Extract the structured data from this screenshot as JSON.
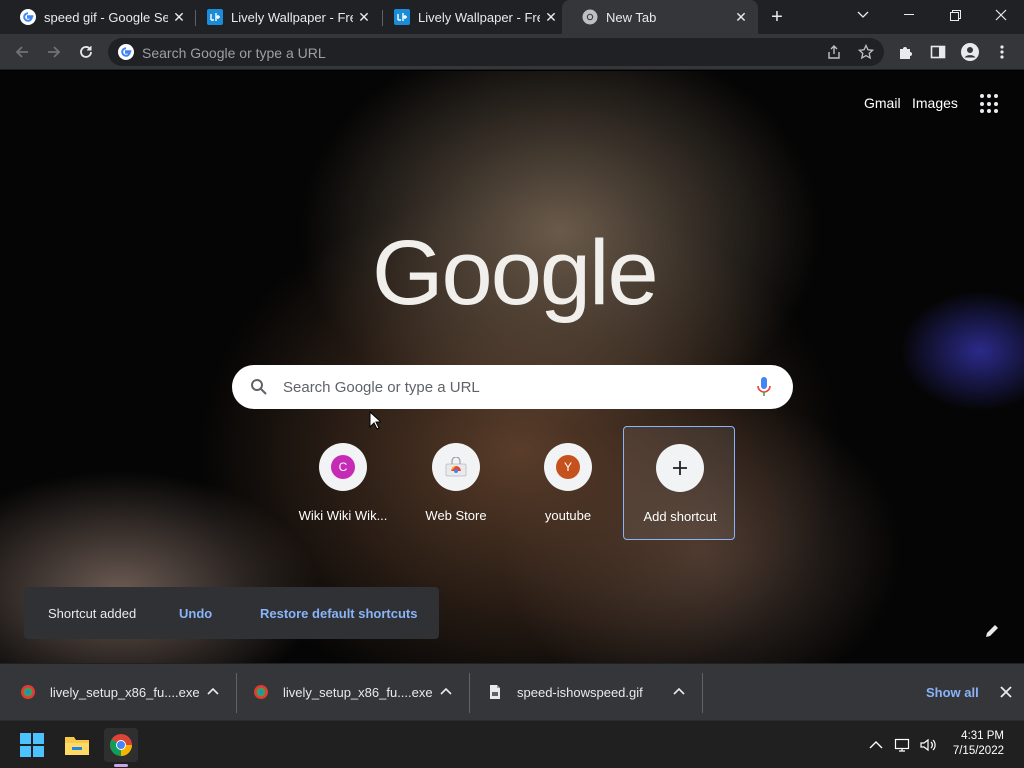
{
  "tabs": [
    {
      "title": "speed gif - Google Search",
      "icon": "google-g-icon",
      "active": false
    },
    {
      "title": "Lively Wallpaper - Free",
      "icon": "lively-icon",
      "active": false
    },
    {
      "title": "Lively Wallpaper - Free",
      "icon": "lively-icon",
      "active": false
    },
    {
      "title": "New Tab",
      "icon": "chrome-icon",
      "active": true
    }
  ],
  "omnibox": {
    "placeholder": "Search Google or type a URL"
  },
  "ntp": {
    "gmail": "Gmail",
    "images": "Images",
    "logo": "Google",
    "search_placeholder": "Search Google or type a URL",
    "shortcuts": [
      {
        "label": "Wiki Wiki Wik...",
        "letter": "C",
        "color": "#c62bb5"
      },
      {
        "label": "Web Store",
        "icon": "webstore-icon"
      },
      {
        "label": "youtube",
        "letter": "Y",
        "color": "#c5511f"
      },
      {
        "label": "Add shortcut",
        "icon": "plus-icon"
      }
    ],
    "toast": {
      "message": "Shortcut added",
      "undo": "Undo",
      "restore": "Restore default shortcuts"
    }
  },
  "downloads": {
    "items": [
      {
        "name": "lively_setup_x86_fu....exe",
        "icon": "lively-installer-icon"
      },
      {
        "name": "lively_setup_x86_fu....exe",
        "icon": "lively-installer-icon"
      },
      {
        "name": "speed-ishowspeed.gif",
        "icon": "file-icon"
      }
    ],
    "show_all": "Show all"
  },
  "taskbar": {
    "time": "4:31 PM",
    "date": "7/15/2022"
  },
  "colors": {
    "accent": "#8ab4f8",
    "chrome_dark": "#35363a",
    "tabstrip": "#202124"
  }
}
